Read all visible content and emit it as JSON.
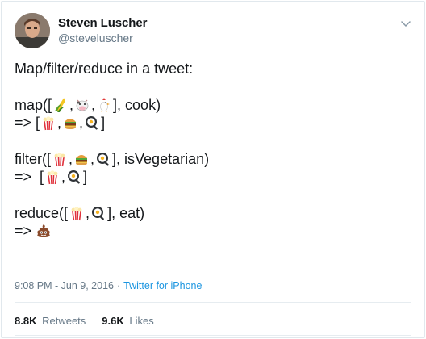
{
  "author": {
    "name": "Steven Luscher",
    "handle": "@steveluscher"
  },
  "tweet": {
    "title_line": "Map/filter/reduce in a tweet:",
    "map_prefix": "map([",
    "map_suffix": "], cook)",
    "map_arrow": "=> [",
    "filter_prefix": "filter([",
    "filter_suffix": "], isVegetarian)",
    "filter_arrow": "=>  [",
    "reduce_prefix": "reduce([",
    "reduce_suffix": "], eat)",
    "reduce_arrow": "=>",
    "close_bracket": "]",
    "comma": ","
  },
  "icons": {
    "corn": "corn-icon",
    "cow": "cow-icon",
    "chicken": "chicken-icon",
    "popcorn": "popcorn-icon",
    "burger": "hamburger-icon",
    "egg": "fried-egg-icon",
    "poop": "poop-icon",
    "caret": "chevron-down-icon"
  },
  "meta": {
    "time": "9:08 PM - Jun 9, 2016",
    "separator": "·",
    "source": "Twitter for iPhone"
  },
  "stats": {
    "retweets_count": "8.8K",
    "retweets_label": "Retweets",
    "likes_count": "9.6K",
    "likes_label": "Likes"
  },
  "colors": {
    "link": "#1b95e0",
    "muted": "#657786",
    "text": "#14171a"
  }
}
